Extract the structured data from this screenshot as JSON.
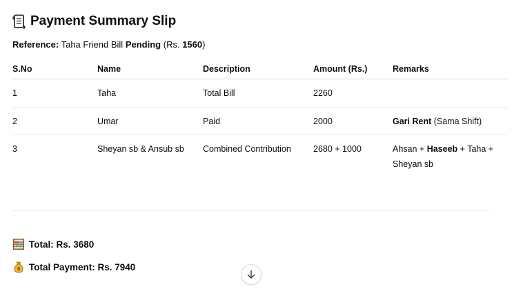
{
  "title": "Payment Summary Slip",
  "reference": {
    "label": "Reference:",
    "text": "Taha Friend Bill",
    "status": "Pending",
    "amount_prefix": "(Rs.",
    "amount": "1560",
    "amount_suffix": ")"
  },
  "table": {
    "headers": [
      "S.No",
      "Name",
      "Description",
      "Amount (Rs.)",
      "Remarks"
    ],
    "rows": [
      {
        "sno": "1",
        "name": "Taha",
        "description": "Total Bill",
        "amount": "2260",
        "remarks": []
      },
      {
        "sno": "2",
        "name": "Umar",
        "description": "Paid",
        "amount": "2000",
        "remarks": [
          {
            "text": "Gari Rent",
            "bold": true
          },
          {
            "text": " (Sama Shift)",
            "bold": false
          }
        ]
      },
      {
        "sno": "3",
        "name": "Sheyan sb & Ansub sb",
        "description": "Combined Contribution",
        "amount": "2680 + 1000",
        "remarks": [
          {
            "text": "Ahsan + ",
            "bold": false
          },
          {
            "text": "Haseeb",
            "bold": true
          },
          {
            "text": " + Taha + Sheyan sb",
            "bold": false
          }
        ]
      }
    ]
  },
  "summary": {
    "total_label": "Total: Rs. 3680",
    "total_icon": "abacus-icon",
    "payment_label": "Total Payment: Rs. 7940",
    "payment_icon": "money-bag-icon"
  },
  "scroll_icon": "arrow-down-icon",
  "colors": {
    "text": "#0d0d0d",
    "border": "#d4d4d4",
    "row_border": "#ececec"
  }
}
